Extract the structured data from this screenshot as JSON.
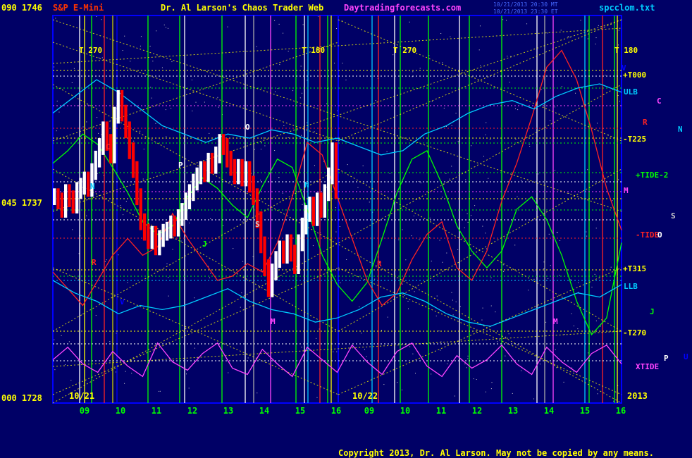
{
  "header": {
    "scale_top": "090 1746",
    "symbol": "S&P E-Mini",
    "title": "Dr. Al Larson's Chaos Trader Web",
    "site": "Daytradingforecasts.com",
    "stamp_line1": "10/21/2013 20:30 MT",
    "stamp_line2": "10/21/2013 23:30 ET",
    "file": "spcclom.txt"
  },
  "copyright": "Copyright 2013, Dr. Al Larson. May not be copied by any means.",
  "colors": {
    "background": "#000066",
    "frame": "#0000ff",
    "gann_dotted": "#ffff00",
    "price_up": "#ffffff",
    "price_down": "#ff0000",
    "tide": "#00ff00",
    "band": "#00ccff",
    "xtide": "#ff44ff",
    "copyright": "#ffff00"
  },
  "chart_data": {
    "type": "bar",
    "title": "S&P E-Mini",
    "y_scale_labels": [
      {
        "label": "090 1746",
        "value": 1746
      },
      {
        "label": "045 1737",
        "value": 1737
      },
      {
        "label": "000 1728",
        "value": 1728
      }
    ],
    "ylim": [
      1728,
      1746
    ],
    "x_tick_labels_day1": [
      "09",
      "10",
      "11",
      "12",
      "13",
      "14",
      "15",
      "16"
    ],
    "x_tick_labels_day2": [
      "09",
      "10",
      "11",
      "12",
      "13",
      "14",
      "15",
      "16"
    ],
    "date_labels": [
      "10/21",
      "10/22",
      "2013"
    ],
    "right_labels": [
      "+T000",
      "ULB",
      "-T225",
      "+TIDE-2",
      "-TIDE",
      "+T315",
      "LLB",
      "-T270",
      "XTIDE"
    ],
    "planet_letters_right": [
      "V",
      "C",
      "R",
      "N",
      "M",
      "S",
      "O",
      "J",
      "P",
      "U"
    ],
    "planet_letters_chart": [
      "R",
      "C",
      "O",
      "P",
      "N",
      "S",
      "J",
      "N",
      "V",
      "M",
      "R",
      "M"
    ],
    "top_markers": [
      "T 270",
      "T 180",
      "T 270",
      "T 180"
    ],
    "price_series": {
      "name": "S&P E-Mini",
      "note_first_hour": "10/21 09-16",
      "values_day1": [
        1737.6,
        1737.4,
        1737.0,
        1737.8,
        1737.5,
        1737.2,
        1737.9,
        1738.1,
        1738.4,
        1738.0,
        1738.8,
        1739.4,
        1740.0,
        1740.8,
        1740.2,
        1739.6,
        1741.5,
        1742.3,
        1741.6,
        1740.8,
        1739.8,
        1738.9,
        1737.6,
        1736.4,
        1735.9,
        1735.5,
        1735.8,
        1735.2,
        1735.6,
        1735.9,
        1736.0,
        1736.3,
        1736.1,
        1736.6,
        1736.9,
        1737.4,
        1737.8,
        1738.3,
        1738.6,
        1738.9,
        1738.7,
        1739.3,
        1739.1,
        1739.6,
        1740.2,
        1740.0,
        1739.4,
        1739.0,
        1738.6,
        1739.0,
        1738.5,
        1738.9,
        1738.2,
        1737.6,
        1736.5,
        1735.3,
        1734.2,
        1733.2,
        1734.0,
        1734.6,
        1735.1,
        1734.8,
        1735.4,
        1734.9,
        1734.3,
        1735.4,
        1736.2,
        1736.8,
        1737.2,
        1736.6,
        1737.4,
        1737.0,
        1737.8,
        1738.6,
        1739.8,
        1737.9
      ]
    },
    "series": [
      {
        "name": "+TIDE-2",
        "values": [
          1739.2,
          1739.8,
          1740.6,
          1740.1,
          1739.0,
          1737.8,
          1736.4,
          1735.8,
          1736.2,
          1737.6,
          1738.5,
          1738.0,
          1737.2,
          1736.6,
          1738.1,
          1739.4,
          1739.0,
          1737.0,
          1734.8,
          1733.4,
          1732.6,
          1733.5,
          1735.6,
          1737.8,
          1739.4,
          1739.8,
          1738.2,
          1736.2,
          1735.0,
          1734.2,
          1735.0,
          1737.0,
          1737.6,
          1736.5,
          1734.8,
          1732.6,
          1731.0,
          1731.8,
          1735.4
        ]
      },
      {
        "name": "-TIDE",
        "values": [
          1734.0,
          1733.2,
          1732.4,
          1733.6,
          1734.8,
          1735.6,
          1734.8,
          1735.2,
          1736.8,
          1735.6,
          1734.6,
          1733.6,
          1733.8,
          1734.4,
          1734.0,
          1735.4,
          1737.6,
          1740.2,
          1739.6,
          1737.6,
          1735.6,
          1733.6,
          1732.4,
          1733.0,
          1734.6,
          1735.8,
          1736.4,
          1734.2,
          1733.6,
          1735.0,
          1737.4,
          1739.2,
          1741.4,
          1743.8,
          1744.6,
          1743.2,
          1740.8,
          1738.0,
          1736.0
        ]
      },
      {
        "name": "ULB",
        "values": [
          1741.6,
          1742.4,
          1743.2,
          1742.6,
          1741.8,
          1741.0,
          1740.6,
          1740.2,
          1740.6,
          1740.4,
          1740.8,
          1740.6,
          1740.2,
          1740.4,
          1740.0,
          1739.6,
          1739.8,
          1740.6,
          1741.0,
          1741.6,
          1742.0,
          1742.2,
          1741.8,
          1742.4,
          1742.8,
          1743.0,
          1742.6
        ]
      },
      {
        "name": "LLB",
        "values": [
          1733.6,
          1733.0,
          1732.6,
          1732.0,
          1732.4,
          1732.2,
          1732.4,
          1732.8,
          1733.2,
          1732.6,
          1732.2,
          1732.0,
          1731.6,
          1731.8,
          1732.2,
          1732.8,
          1733.0,
          1732.6,
          1732.0,
          1731.6,
          1731.4,
          1731.8,
          1732.2,
          1732.6,
          1733.0,
          1732.8,
          1733.4
        ]
      },
      {
        "name": "XTIDE",
        "values": [
          1729.8,
          1730.4,
          1729.6,
          1729.2,
          1730.2,
          1729.5,
          1729.0,
          1730.6,
          1729.7,
          1729.3,
          1730.1,
          1730.6,
          1729.4,
          1729.1,
          1730.3,
          1729.6,
          1729.0,
          1730.4,
          1729.8,
          1729.2,
          1730.5,
          1729.7,
          1729.1,
          1730.2,
          1730.6,
          1729.5,
          1729.0,
          1730.0,
          1729.4,
          1729.8,
          1730.5,
          1729.6,
          1729.1,
          1730.4,
          1729.7,
          1729.2,
          1730.1,
          1730.5,
          1729.6
        ]
      }
    ],
    "grid": true,
    "legend": "right"
  }
}
